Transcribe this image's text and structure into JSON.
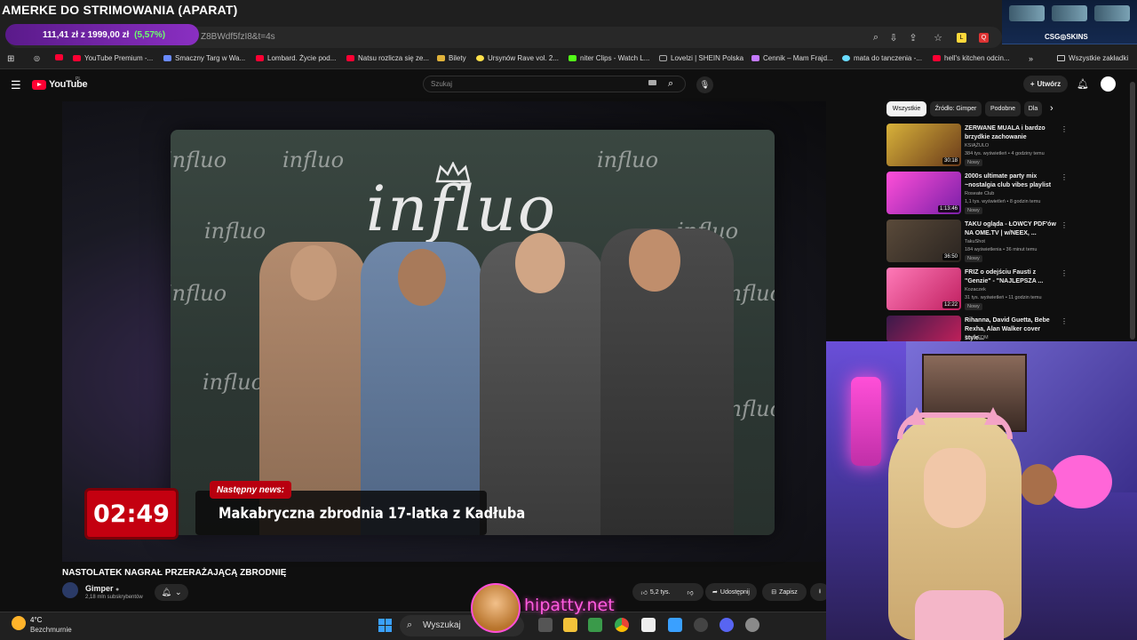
{
  "stream": {
    "title": "AMERKE DO STRIMOWANIA (APARAT)",
    "streamer_name": "hipatty.net"
  },
  "donation": {
    "current": "111,41 zł",
    "sep": "z",
    "goal": "1999,00 zł",
    "percent": "(5,57%)"
  },
  "browser": {
    "url_fragment": "Z8BWdf5fzI8&t=4s"
  },
  "ad_banner": {
    "text": "CSG◎SKINS"
  },
  "bookmarks": [
    {
      "label": "YouTube Premium -..."
    },
    {
      "label": "Smaczny Targ w Wa..."
    },
    {
      "label": "Lombard. Życie pod..."
    },
    {
      "label": "Natsu rozlicza się ze..."
    },
    {
      "label": "Bilety"
    },
    {
      "label": "Ursynów Rave vol. 2..."
    },
    {
      "label": "niter Clips - Watch L..."
    },
    {
      "label": "Lovelzi | SHEIN Polska"
    },
    {
      "label": "Cennik – Mam Frajd..."
    },
    {
      "label": "mata do tanczenia -..."
    },
    {
      "label": "hell's kitchen odcin..."
    }
  ],
  "bookmarks_all": "Wszystkie zakładki",
  "youtube": {
    "logo": "YouTube",
    "region": "PL",
    "search_placeholder": "Szukaj",
    "create_label": "Utwórz"
  },
  "player": {
    "overlay_word": "influo",
    "next_news_tag": "Następny news:",
    "headline": "Makabryczna zbrodnia 17-latka z Kadłuba",
    "timer": "02:49"
  },
  "video": {
    "title": "NASTOLATEK NAGRAŁ PRZERAŻAJĄCĄ ZBRODNIĘ",
    "channel": "Gimper",
    "subscribers": "2,18 mln subskrybentów",
    "likes": "5,2 tys.",
    "share": "Udostępnij",
    "save": "Zapisz"
  },
  "chips": [
    {
      "label": "Wszystkie",
      "active": true
    },
    {
      "label": "Źródło: Gimper"
    },
    {
      "label": "Podobne"
    },
    {
      "label": "Dla"
    }
  ],
  "recommendations": [
    {
      "title": "ZERWANE MUALA i bardzo brzydkie zachowanie",
      "channel": "KSIĄŻULO",
      "meta": "384 tys. wyświetleń • 4 godziny temu",
      "badge": "Nowy",
      "duration": "30:18",
      "c1": "#d8b23a",
      "c2": "#6a3a1a"
    },
    {
      "title": "2000s ultimate party mix ~nostalgia club vibes playlist",
      "channel": "Roseate Club",
      "meta": "1,1 tys. wyświetleń • 8 godzin temu",
      "badge": "Nowy",
      "duration": "1:13:46",
      "c1": "#ff4fd8",
      "c2": "#7a1fa8"
    },
    {
      "title": "TAKU ogląda - ŁOWCY PDF'ów NA OME.TV | w/NEEX, ...",
      "channel": "TakuShot",
      "meta": "184 wyświetlenia • 36 minut temu",
      "badge": "Nowy",
      "duration": "36:50",
      "c1": "#5a4a3a",
      "c2": "#2a2420"
    },
    {
      "title": "FRIZ o odejściu Fausti z \"Genzie\" - \"NAJLEPSZA ...",
      "channel": "Kozaczek",
      "meta": "31 tys. wyświetleń • 11 godzin temu",
      "badge": "Nowy",
      "duration": "12:22",
      "c1": "#ff7ab8",
      "c2": "#c02060"
    },
    {
      "title": "Rihanna, David Guetta, Bebe Rexha, Alan Walker cover style...",
      "channel": "Tasty EDM",
      "meta": "",
      "badge": "",
      "duration": "",
      "c1": "#3a1a4a",
      "c2": "#c0205a"
    }
  ],
  "taskbar": {
    "temp": "4°C",
    "weather": "Bezchmurnie",
    "search": "Wyszukaj"
  }
}
